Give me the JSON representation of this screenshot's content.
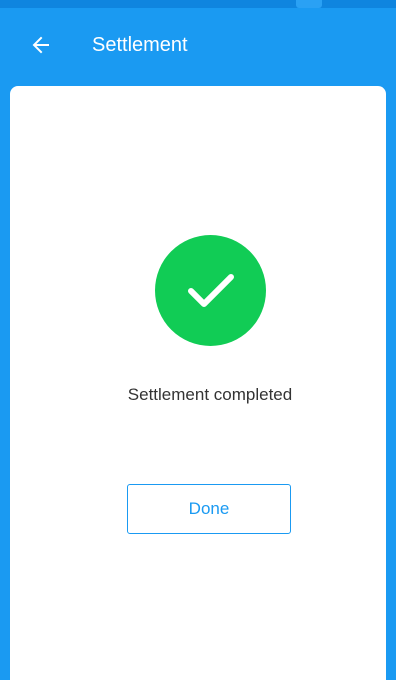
{
  "appbar": {
    "title": "Settlement",
    "back_icon": "arrow-left-icon"
  },
  "result": {
    "icon": "checkmark-icon",
    "message": "Settlement completed",
    "done_label": "Done"
  },
  "colors": {
    "primary": "#1a9af2",
    "success": "#11cc55",
    "text": "#333333",
    "card": "#ffffff"
  }
}
